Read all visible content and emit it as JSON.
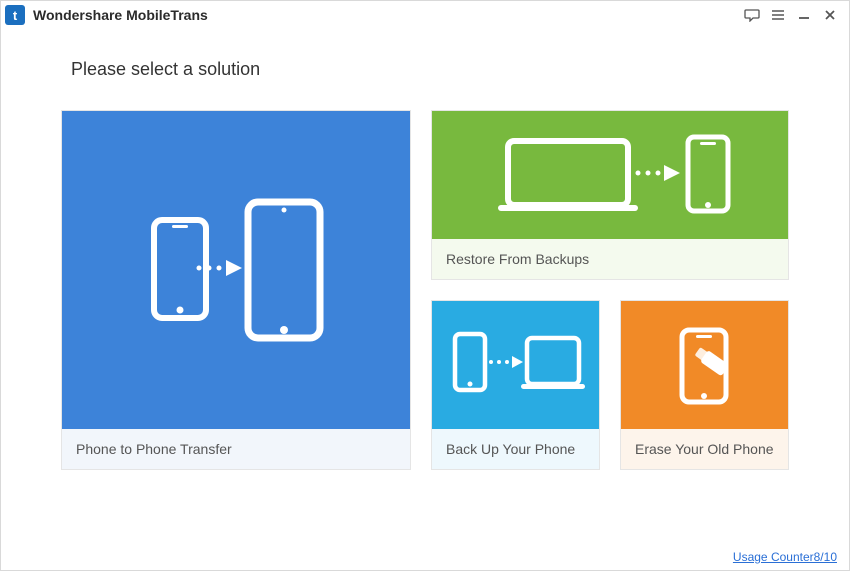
{
  "app": {
    "title": "Wondershare MobileTrans",
    "logo_letter": "t"
  },
  "heading": "Please select a solution",
  "cards": {
    "phone_to_phone": {
      "label": "Phone to Phone Transfer"
    },
    "restore": {
      "label": "Restore From Backups"
    },
    "backup": {
      "label": "Back Up Your Phone"
    },
    "erase": {
      "label": "Erase Your Old Phone"
    }
  },
  "footer": {
    "usage_counter": "Usage Counter8/10"
  },
  "colors": {
    "p2p": "#3d83d9",
    "restore": "#78b93e",
    "backup": "#29abe2",
    "erase": "#f18a27"
  }
}
